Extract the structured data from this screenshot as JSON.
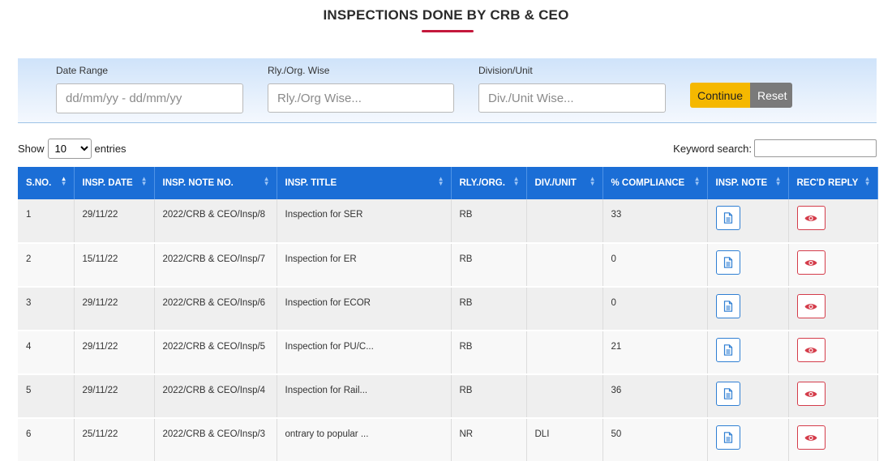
{
  "page": {
    "title": "INSPECTIONS DONE BY CRB & CEO"
  },
  "filters": {
    "date_range": {
      "label": "Date Range",
      "placeholder": "dd/mm/yy - dd/mm/yy"
    },
    "rly_org": {
      "label": "Rly./Org. Wise",
      "placeholder": "Rly./Org Wise..."
    },
    "division": {
      "label": "Division/Unit",
      "placeholder": "Div./Unit Wise..."
    },
    "continue_label": "Continue",
    "reset_label": "Reset"
  },
  "controls": {
    "show_label": "Show",
    "entries_value": "10",
    "entries_label": "entries",
    "search_label": "Keyword search:"
  },
  "table": {
    "headers": [
      "S.NO.",
      "INSP. DATE",
      "INSP. NOTE NO.",
      "INSP. TITLE",
      "RLY./ORG.",
      "DIV./UNIT",
      "% COMPLIANCE",
      "INSP. NOTE",
      "REC'D REPLY"
    ],
    "rows": [
      {
        "sno": "1",
        "date": "29/11/22",
        "note_no": "2022/CRB & CEO/Insp/8",
        "title": "Inspection for SER",
        "rly": "RB",
        "div": "",
        "compliance": "33"
      },
      {
        "sno": "2",
        "date": "15/11/22",
        "note_no": "2022/CRB & CEO/Insp/7",
        "title": "Inspection for ER",
        "rly": "RB",
        "div": "",
        "compliance": "0"
      },
      {
        "sno": "3",
        "date": "29/11/22",
        "note_no": "2022/CRB & CEO/Insp/6",
        "title": "Inspection for ECOR",
        "rly": "RB",
        "div": "",
        "compliance": "0"
      },
      {
        "sno": "4",
        "date": "29/11/22",
        "note_no": "2022/CRB & CEO/Insp/5",
        "title": "Inspection for PU/C...",
        "rly": "RB",
        "div": "",
        "compliance": "21"
      },
      {
        "sno": "5",
        "date": "29/11/22",
        "note_no": "2022/CRB & CEO/Insp/4",
        "title": "Inspection for Rail...",
        "rly": "RB",
        "div": "",
        "compliance": "36"
      },
      {
        "sno": "6",
        "date": "25/11/22",
        "note_no": "2022/CRB & CEO/Insp/3",
        "title": "ontrary to popular ...",
        "rly": "NR",
        "div": "DLI",
        "compliance": "50"
      }
    ]
  },
  "icons": {
    "note": "document-icon",
    "reply": "eye-icon",
    "sort": "sort-icon"
  },
  "colors": {
    "header_bg": "#1b6ed6",
    "accent": "#c4183c",
    "continue": "#f5b800",
    "reset": "#7a7a7a",
    "reply_icon": "#d43c4a",
    "note_icon": "#2f7fd3"
  }
}
